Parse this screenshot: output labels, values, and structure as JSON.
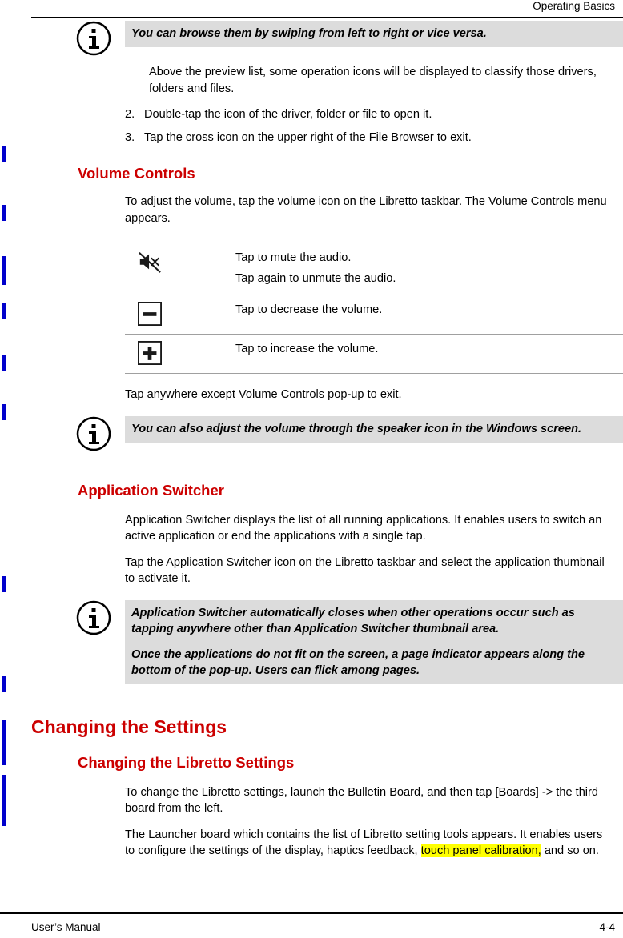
{
  "header": {
    "title": "Operating Basics"
  },
  "footer": {
    "left": "User’s Manual",
    "right": "4-4"
  },
  "content": {
    "note1": {
      "icon": "info-icon",
      "line1": "You can browse them by swiping from left to right or vice versa."
    },
    "intro_indent": "Above the preview list, some operation icons will be displayed to classify those drivers, folders and files.",
    "steps": [
      {
        "num": "2.",
        "text": "Double-tap the icon of the driver, folder or file to open it."
      },
      {
        "num": "3.",
        "text": "Tap the cross icon on the upper right of the File Browser to exit."
      }
    ],
    "volume_controls": {
      "heading": "Volume Controls",
      "intro": "To adjust the volume, tap the volume icon on the Libretto taskbar. The Volume Controls menu appears.",
      "rows": [
        {
          "icon": "mute-speaker-icon",
          "lines": [
            "Tap to mute the audio.",
            "Tap again to unmute the audio."
          ]
        },
        {
          "icon": "minus-icon",
          "lines": [
            "Tap to decrease the volume."
          ]
        },
        {
          "icon": "plus-icon",
          "lines": [
            "Tap to increase the volume."
          ]
        }
      ],
      "after": "Tap anywhere except Volume Controls pop-up to exit.",
      "note": {
        "icon": "info-icon",
        "line1": "You can also adjust the volume through the speaker icon in the Windows screen."
      }
    },
    "application_switcher": {
      "heading": "Application Switcher",
      "para1": "Application Switcher displays the list of all running applications. It enables users to switch an active application or end the applications with a single tap.",
      "para2": "Tap the Application Switcher icon on the Libretto taskbar and select the application thumbnail to activate it.",
      "note": {
        "icon": "info-icon",
        "line1": "Application Switcher automatically closes when other operations occur such as tapping anywhere other than Application Switcher thumbnail area.",
        "line2": "Once the applications do not fit on the screen, a page indicator appears along the bottom of the pop-up. Users can flick among pages."
      }
    },
    "changing_settings": {
      "heading": "Changing the Settings",
      "sub_heading": "Changing the Libretto Settings",
      "para1": "To change the Libretto settings, launch the Bulletin Board, and then tap [Boards] -> the third board from the left.",
      "para2_pre": "The Launcher board which contains the list of Libretto setting tools appears. It enables users to configure the settings of the display, haptics feedback, ",
      "para2_highlight": "touch panel calibration,",
      "para2_post": " and so on."
    }
  },
  "colors": {
    "heading_red": "#cc0000",
    "note_bg": "#dcdcdc",
    "changebar": "#0000cc",
    "highlight": "#ffff00"
  }
}
